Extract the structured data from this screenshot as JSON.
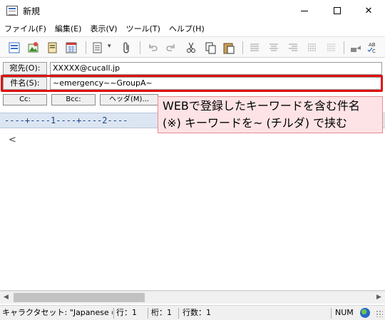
{
  "window": {
    "title": "新規",
    "minimize_glyph": "—",
    "maximize_glyph": "☐",
    "close_glyph": "✕"
  },
  "menu": {
    "items": [
      {
        "label": "ファイル(F)"
      },
      {
        "label": "編集(E)"
      },
      {
        "label": "表示(V)"
      },
      {
        "label": "ツール(T)"
      },
      {
        "label": "ヘルプ(H)"
      }
    ]
  },
  "toolbar": {
    "icons": [
      "send-icon",
      "attach-image-icon",
      "address-book-icon",
      "calendar-icon",
      "template-icon",
      "paperclip-icon",
      "undo-icon",
      "redo-icon",
      "cut-icon",
      "copy-icon",
      "paste-icon",
      "align-left-icon",
      "align-center-icon",
      "align-right-icon",
      "quote-icon",
      "stamp-icon",
      "spellcheck-icon"
    ],
    "chevron": "▾"
  },
  "headers": {
    "to_label": "宛先(O):",
    "to_value": "XXXXX@cucall.jp",
    "subject_label": "件名(S):",
    "subject_value": "~emergency~~GroupA~",
    "cc_label": "Cc:",
    "bcc_label": "Bcc:",
    "header_label": "ヘッダ(M)..."
  },
  "callout": {
    "line1": "WEBで登録したキーワードを含む件名",
    "line2": "(※) キーワードを~ (チルダ) で挟む"
  },
  "editor": {
    "ruler": "----+----1----+----2----",
    "body": "<"
  },
  "scrollbar": {
    "left_arrow": "◀",
    "right_arrow": "▶"
  },
  "status": {
    "charset": "キャラクタセット: \"Japanese (ISO",
    "line": "行：1",
    "column": "桁：1",
    "line_count": "行数：1",
    "num": "NUM"
  },
  "colors": {
    "highlight_border": "#e01010",
    "callout_bg": "#fde3e5",
    "ruler_bg": "#dce6f2"
  }
}
